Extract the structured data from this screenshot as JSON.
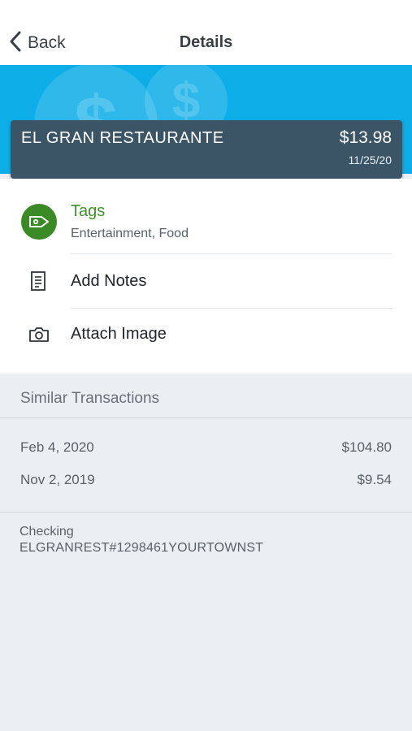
{
  "nav": {
    "back_label": "Back",
    "title": "Details"
  },
  "transaction": {
    "merchant": "EL GRAN RESTAURANTE",
    "amount": "$13.98",
    "date": "11/25/20"
  },
  "actions": {
    "tags_title": "Tags",
    "tags_value": "Entertainment, Food",
    "add_notes": "Add Notes",
    "attach_image": "Attach Image"
  },
  "similar": {
    "header": "Similar Transactions",
    "items": [
      {
        "date": "Feb 4, 2020",
        "amount": "$104.80"
      },
      {
        "date": "Nov 2, 2019",
        "amount": "$9.54"
      }
    ]
  },
  "account": {
    "type": "Checking",
    "description": "ELGRANREST#1298461YOURTOWNST"
  },
  "icons": {
    "back": "chevron-left-icon",
    "tag": "tag-icon",
    "notes": "document-icon",
    "camera": "camera-icon",
    "banner": "dollar-coin-icon"
  },
  "colors": {
    "banner": "#0daee8",
    "card": "#3c5566",
    "accent_green": "#3a8a26",
    "background": "#ebeef3"
  }
}
